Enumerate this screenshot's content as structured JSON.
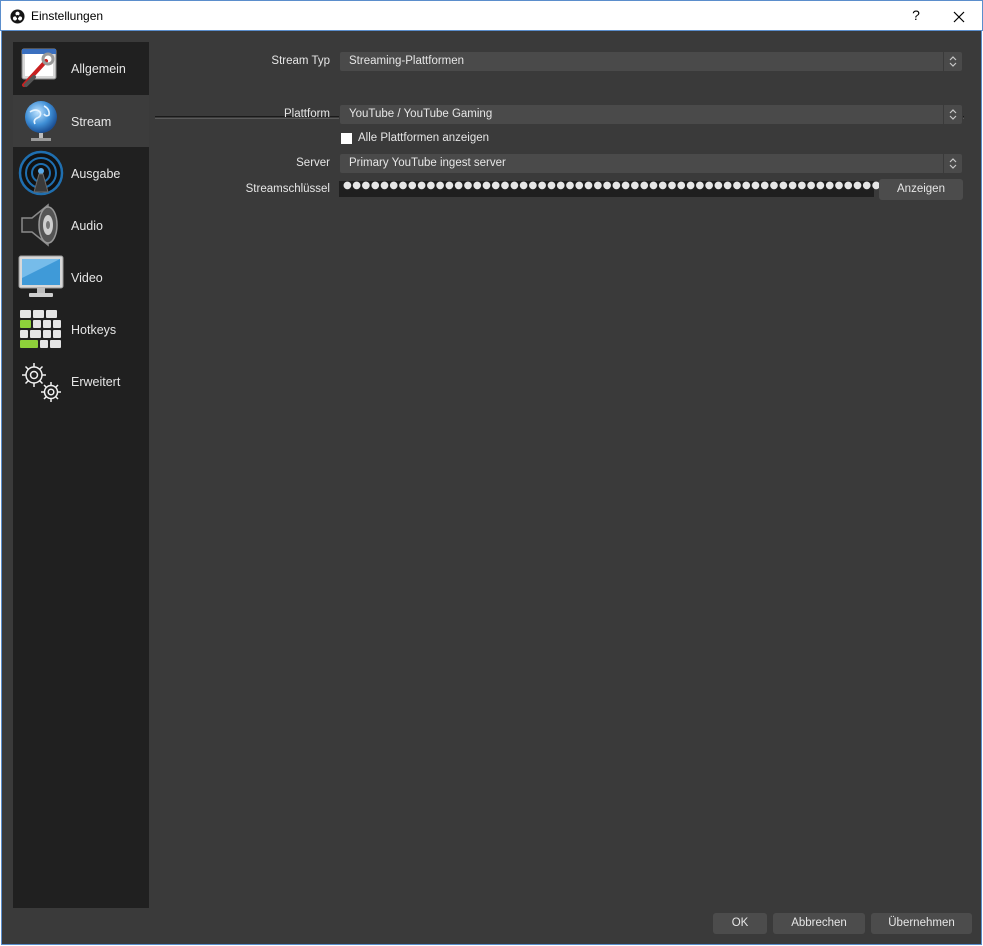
{
  "window": {
    "title": "Einstellungen",
    "help_label": "?"
  },
  "sidebar": {
    "items": [
      {
        "label": "Allgemein",
        "icon": "general-icon"
      },
      {
        "label": "Stream",
        "icon": "globe-icon"
      },
      {
        "label": "Ausgabe",
        "icon": "broadcast-icon"
      },
      {
        "label": "Audio",
        "icon": "speaker-icon"
      },
      {
        "label": "Video",
        "icon": "monitor-icon"
      },
      {
        "label": "Hotkeys",
        "icon": "keyboard-icon"
      },
      {
        "label": "Erweitert",
        "icon": "gears-icon"
      }
    ],
    "active": "Stream"
  },
  "stream": {
    "type_label": "Stream Typ",
    "type_value": "Streaming-Plattformen",
    "platform_label": "Plattform",
    "platform_value": "YouTube / YouTube Gaming",
    "show_all_label": "Alle Plattformen anzeigen",
    "show_all_checked": false,
    "server_label": "Server",
    "server_value": "Primary YouTube ingest server",
    "key_label": "Streamschlüssel",
    "key_masked": "●●●●●●●●●●●●●●●●●●●●●●●●●●●●●●●●●●●●●●●●●●●●●●●●●●●●●●●●●●●●",
    "show_key_label": "Anzeigen"
  },
  "footer": {
    "ok_label": "OK",
    "cancel_label": "Abbrechen",
    "apply_label": "Übernehmen"
  },
  "colors": {
    "background": "#3a3a3a",
    "sidebar": "#202020",
    "active_item": "#3c3c3c",
    "text": "#e6e6e6"
  }
}
